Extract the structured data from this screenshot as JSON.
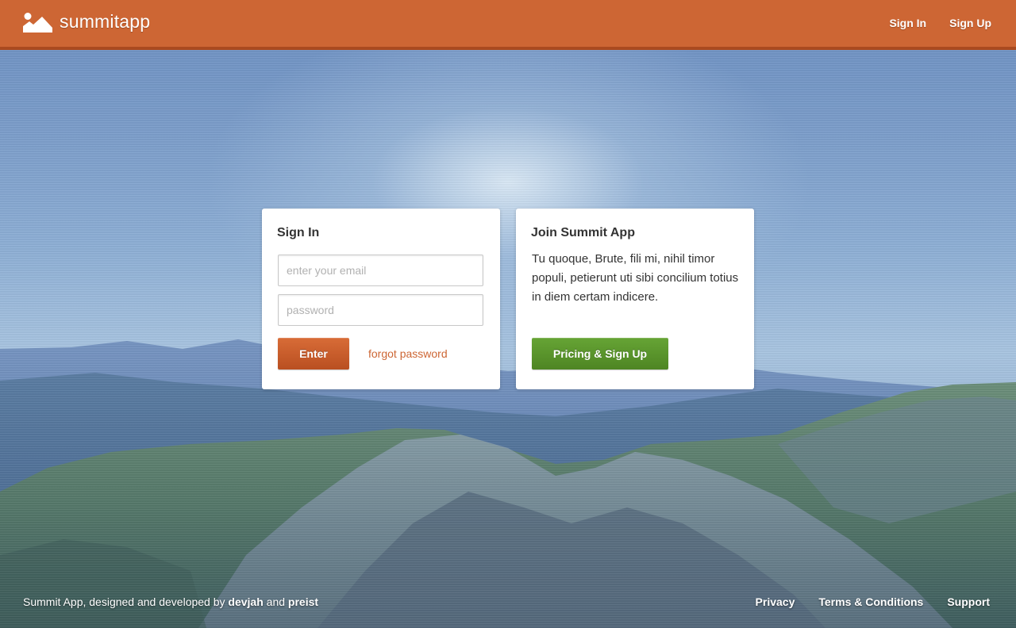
{
  "header": {
    "brand": "summitapp",
    "nav": [
      "Sign In",
      "Sign Up"
    ]
  },
  "signin": {
    "title": "Sign In",
    "email_placeholder": "enter your email",
    "password_placeholder": "password",
    "enter_label": "Enter",
    "forgot_label": "forgot password"
  },
  "join": {
    "title": "Join Summit App",
    "text": "Tu quoque, Brute, fili mi, nihil timor populi, petierunt uti sibi concilium totius in diem certam indicere.",
    "button_label": "Pricing & Sign Up"
  },
  "footer": {
    "credit_prefix": "Summit App, designed and developed by",
    "credit_author1": "devjah",
    "credit_and": "and",
    "credit_author2": "preist",
    "links": [
      "Privacy",
      "Terms & Conditions",
      "Support"
    ]
  },
  "colors": {
    "brand_orange": "#cd6634",
    "enter_button": "#c45a2a",
    "pricing_button": "#5a952c"
  }
}
